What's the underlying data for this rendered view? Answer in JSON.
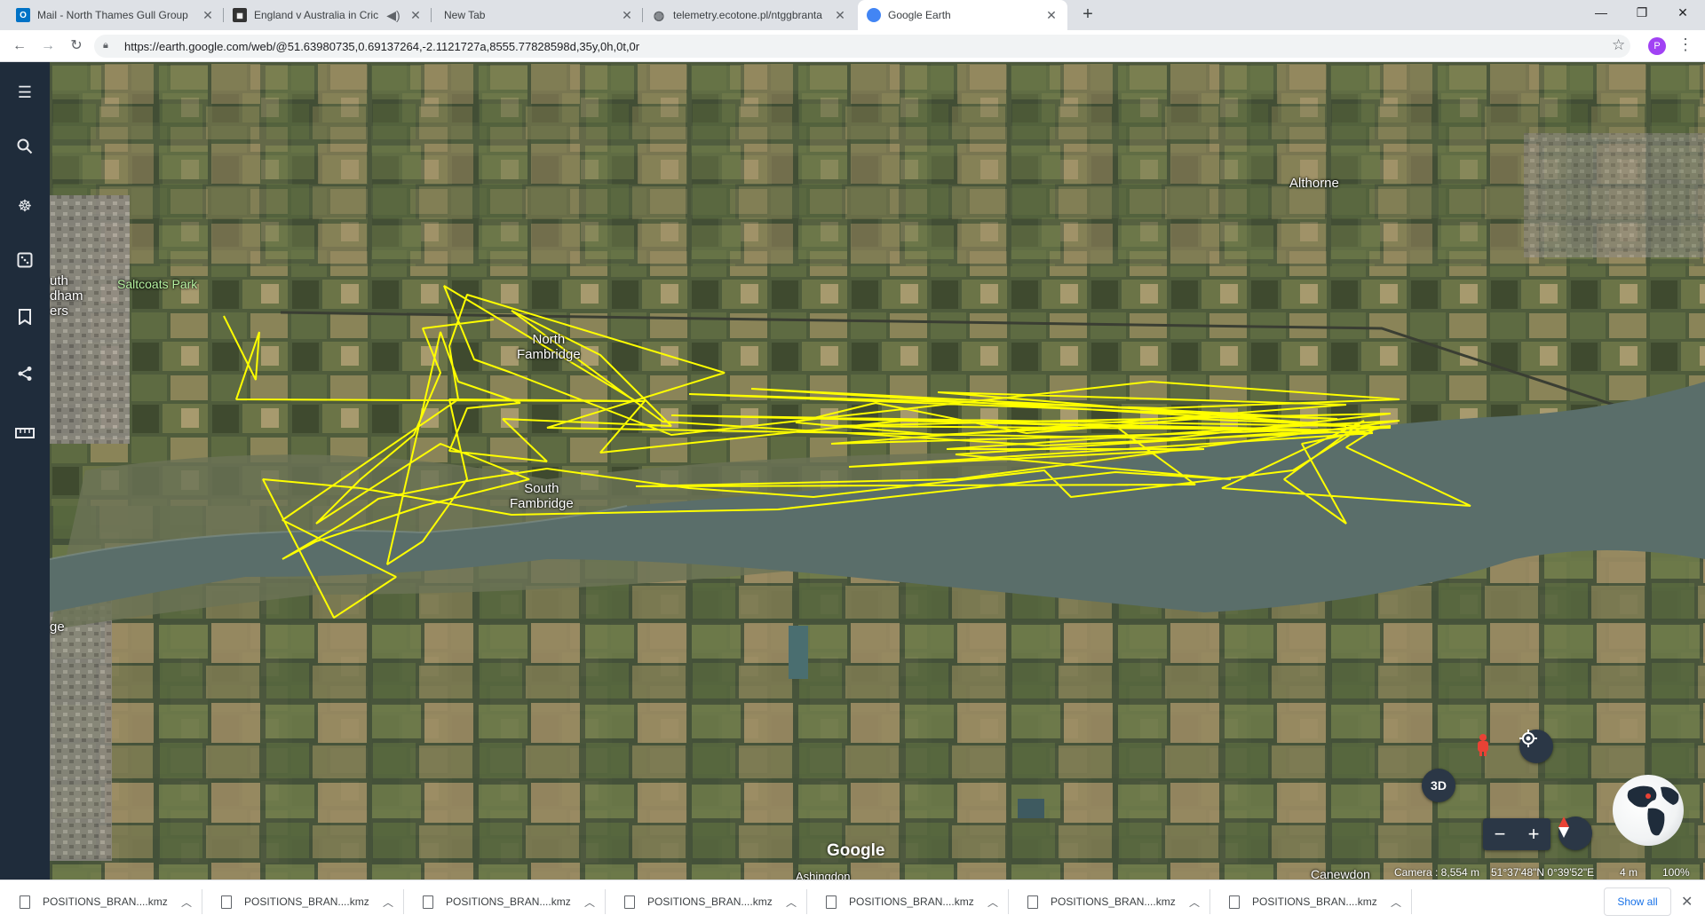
{
  "tabs": [
    {
      "title": "Mail - North Thames Gull Group",
      "icon": "outlook-icon",
      "color": "#0072c6"
    },
    {
      "title": "England v Australia in Cricket",
      "icon": "cricket-icon",
      "color": "#333333"
    },
    {
      "title": "New Tab",
      "icon": "",
      "color": ""
    },
    {
      "title": "telemetry.ecotone.pl/ntggbranta",
      "icon": "globe-icon",
      "color": "#5f6368"
    },
    {
      "title": "Google Earth",
      "icon": "google-earth-icon",
      "color": "#4285f4"
    }
  ],
  "address": {
    "url": "https://earth.google.com/web/@51.63980735,0.69137264,-2.1121727a,8555.77828598d,35y,0h,0t,0r"
  },
  "profile_initial": "P",
  "places": {
    "althorne": "Althorne",
    "saltcoats": "Saltcoats Park",
    "north_fambridge": "North\nFambridge",
    "south_fambridge": "South\nFambridge",
    "south_woodham_line1": "uth",
    "south_woodham_line2": "dham",
    "south_woodham_line3": "ers",
    "edge": "ge",
    "ashingdon": "Ashingdon",
    "canewdon": "Canewdon"
  },
  "map_controls": {
    "three_d": "3D",
    "zoom_out": "−",
    "zoom_in": "+"
  },
  "google_logo": "Google",
  "status": {
    "camera": "Camera : 8,554 m",
    "coords": "51°37'48\"N 0°39'52\"E",
    "altitude": "4 m",
    "zoom": "100%"
  },
  "downloads": [
    {
      "name": "POSITIONS_BRAN....kmz"
    },
    {
      "name": "POSITIONS_BRAN....kmz"
    },
    {
      "name": "POSITIONS_BRAN....kmz"
    },
    {
      "name": "POSITIONS_BRAN....kmz"
    },
    {
      "name": "POSITIONS_BRAN....kmz"
    },
    {
      "name": "POSITIONS_BRAN....kmz"
    },
    {
      "name": "POSITIONS_BRAN....kmz"
    }
  ],
  "show_all": "Show all",
  "colors": {
    "track": "#ffff00",
    "sidebar": "#1f2c3b",
    "river": "#5a6e6a"
  }
}
